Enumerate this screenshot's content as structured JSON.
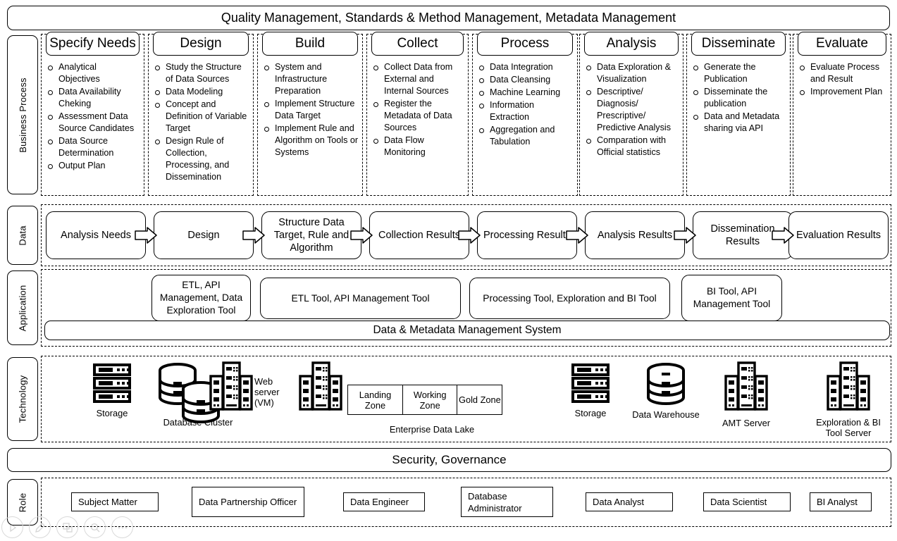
{
  "banner": {
    "title": "Quality Management, Standards & Method Management, Metadata Management"
  },
  "rows": {
    "business_process": "Business Process",
    "data": "Data",
    "application": "Application",
    "technology": "Technology",
    "role": "Role"
  },
  "business_process": {
    "phases": [
      {
        "title": "Specify Needs",
        "items": [
          "Analytical Objectives",
          "Data Availability Cheking",
          "Assessment Data Source Candidates",
          "Data Source Determination",
          "Output Plan"
        ]
      },
      {
        "title": "Design",
        "items": [
          "Study the Structure of Data Sources",
          "Data Modeling",
          "Concept and Definition of Variable Target",
          "Design Rule of Collection, Processing, and Dissemination"
        ]
      },
      {
        "title": "Build",
        "items": [
          "System and Infrastructure Preparation",
          "Implement Structure Data Target",
          "Implement Rule and Algorithm on Tools or Systems"
        ]
      },
      {
        "title": "Collect",
        "items": [
          "Collect Data from External and Internal Sources",
          "Register the Metadata of Data Sources",
          "Data Flow Monitoring"
        ]
      },
      {
        "title": "Process",
        "items": [
          "Data Integration",
          "Data Cleansing",
          "Machine Learning",
          "Information Extraction",
          "Aggregation and Tabulation"
        ]
      },
      {
        "title": "Analysis",
        "items": [
          "Data Exploration & Visualization",
          "Descriptive/ Diagnosis/ Prescriptive/ Predictive Analysis",
          "Comparation with Official statistics"
        ]
      },
      {
        "title": "Disseminate",
        "items": [
          "Generate the Publication",
          "Disseminate the publication",
          "Data and Metadata sharing via API"
        ]
      },
      {
        "title": "Evaluate",
        "items": [
          "Evaluate Process and Result",
          "Improvement Plan"
        ]
      }
    ]
  },
  "data_flow": {
    "stages": [
      "Analysis Needs",
      "Design",
      "Structure Data Target, Rule and Algorithm",
      "Collection Results",
      "Processing Results",
      "Analysis Results",
      "Dissemination Results",
      "Evaluation Results"
    ]
  },
  "application": {
    "tools": [
      "ETL, API Management, Data Exploration Tool",
      "ETL Tool, API Management Tool",
      "Processing Tool, Exploration and BI Tool",
      "BI Tool, API Management Tool"
    ],
    "platform": "Data & Metadata Management System"
  },
  "technology": {
    "items": [
      {
        "label": "Storage",
        "icon": "server-rack-icon"
      },
      {
        "label": "Database Cluster",
        "icon": "database-cluster-icon"
      },
      {
        "label": "Web server (VM)",
        "icon": "datacenter-building-icon"
      },
      {
        "label": "Enterprise Data Lake",
        "icon": "datacenter-building-icon"
      },
      {
        "label": "Storage",
        "icon": "server-rack-icon"
      },
      {
        "label": "Data Warehouse",
        "icon": "database-icon"
      },
      {
        "label": "AMT Server",
        "icon": "datacenter-building-icon"
      },
      {
        "label": "Exploration & BI Tool Server",
        "icon": "datacenter-building-icon"
      }
    ],
    "data_lake_zones": [
      "Landing Zone",
      "Working Zone",
      "Gold Zone"
    ]
  },
  "security": {
    "title": "Security, Governance"
  },
  "role": {
    "roles": [
      "Subject Matter",
      "Data Partnership Officer",
      "Data Engineer",
      "Database Administrator",
      "Data Analyst",
      "Data Scientist",
      "BI Analyst"
    ]
  },
  "mini_toolbar": {
    "icons": [
      "play-icon",
      "pencil-icon",
      "shapes-icon",
      "magnifier-icon",
      "ellipsis-icon"
    ]
  },
  "colors": {
    "stroke": "#000000",
    "background": "#ffffff",
    "muted": "#d9d9d9"
  }
}
